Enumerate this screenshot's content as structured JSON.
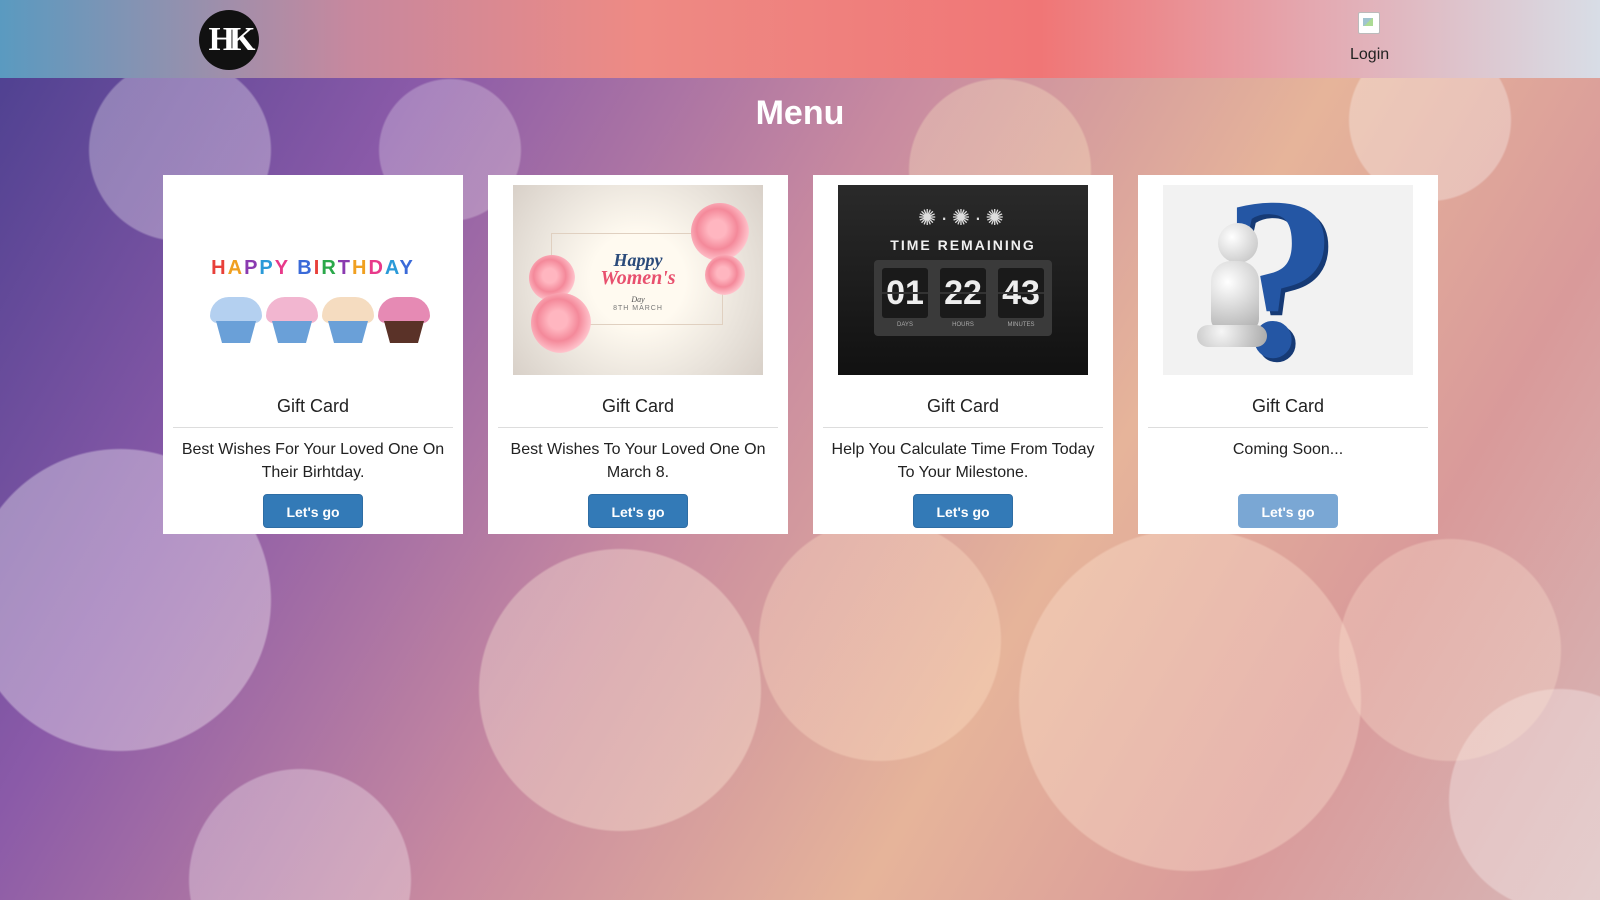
{
  "header": {
    "logo_text": "HK",
    "login_label": "Login"
  },
  "page_title": "Menu",
  "cards": [
    {
      "title": "Gift Card",
      "description": "Best Wishes For Your Loved One On Their Birhtday.",
      "button_label": "Let's go",
      "button_enabled": true,
      "image": {
        "letters": "HAPPY BIRTHDAY"
      }
    },
    {
      "title": "Gift Card",
      "description": "Best Wishes To Your Loved One On March 8.",
      "button_label": "Let's go",
      "button_enabled": true,
      "image": {
        "line1": "Happy",
        "line2": "Women's",
        "line3": "Day",
        "line4": "8TH MARCH"
      }
    },
    {
      "title": "Gift Card",
      "description": "Help You Calculate Time From Today To Your Milestone.",
      "button_label": "Let's go",
      "button_enabled": true,
      "image": {
        "heading": "TIME REMAINING",
        "days": "01",
        "hours": "22",
        "minutes": "43",
        "days_label": "DAYS",
        "hours_label": "HOURS",
        "minutes_label": "MINUTES"
      }
    },
    {
      "title": "Gift Card",
      "description": "Coming Soon...",
      "button_label": "Let's go",
      "button_enabled": false,
      "image": {
        "icon": "question-mark-figure"
      }
    }
  ],
  "colors": {
    "button": "#337ab7",
    "button_disabled": "#7aa7d4",
    "title_text": "#ffffff"
  }
}
